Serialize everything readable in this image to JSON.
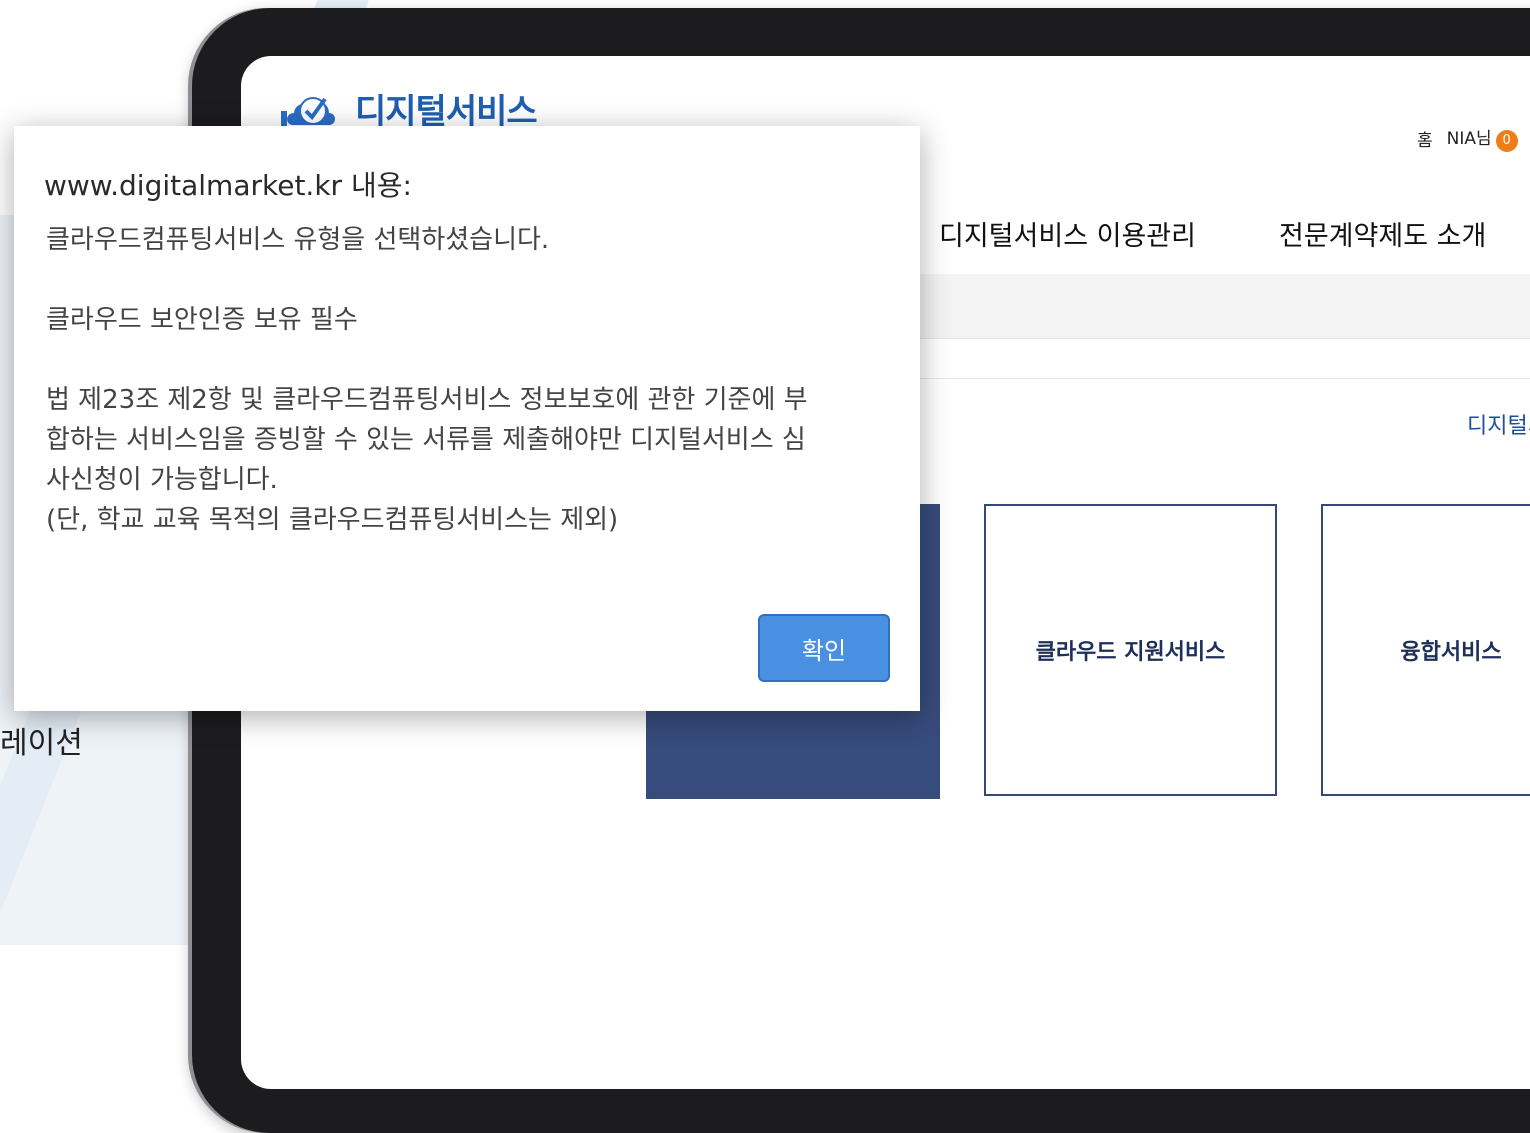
{
  "background": {
    "partial_text": "레이션"
  },
  "site": {
    "logo_text": "디지털서비스",
    "util_nav": {
      "home": "홈",
      "user": "NIA님",
      "badge_count": "0"
    },
    "gnb": [
      "디지털서비스 이용관리",
      "전문계약제도 소개"
    ],
    "breadcrumb": "디지털서",
    "cards": [
      "클라우드 지원서비스",
      "융합서비스"
    ]
  },
  "dialog": {
    "title": "www.digitalmarket.kr 내용:",
    "line1": "클라우드컴퓨팅서비스 유형을 선택하셨습니다.",
    "line2": "클라우드 보안인증 보유 필수",
    "line3a": "법 제23조 제2항 및 클라우드컴퓨팅서비스 정보보호에 관한 기준에 부",
    "line3b": "합하는 서비스임을 증빙할 수 있는 서류를 제출해야만 디지털서비스 심",
    "line3c": "사신청이 가능합니다.",
    "line4": "(단, 학교 교육 목적의 클라우드컴퓨팅서비스는 제외)",
    "ok_label": "확인"
  },
  "colors": {
    "brand_blue": "#1f5fb0",
    "card_navy": "#374b7c",
    "badge_orange": "#ef7d18",
    "button_blue": "#4a90e2"
  }
}
